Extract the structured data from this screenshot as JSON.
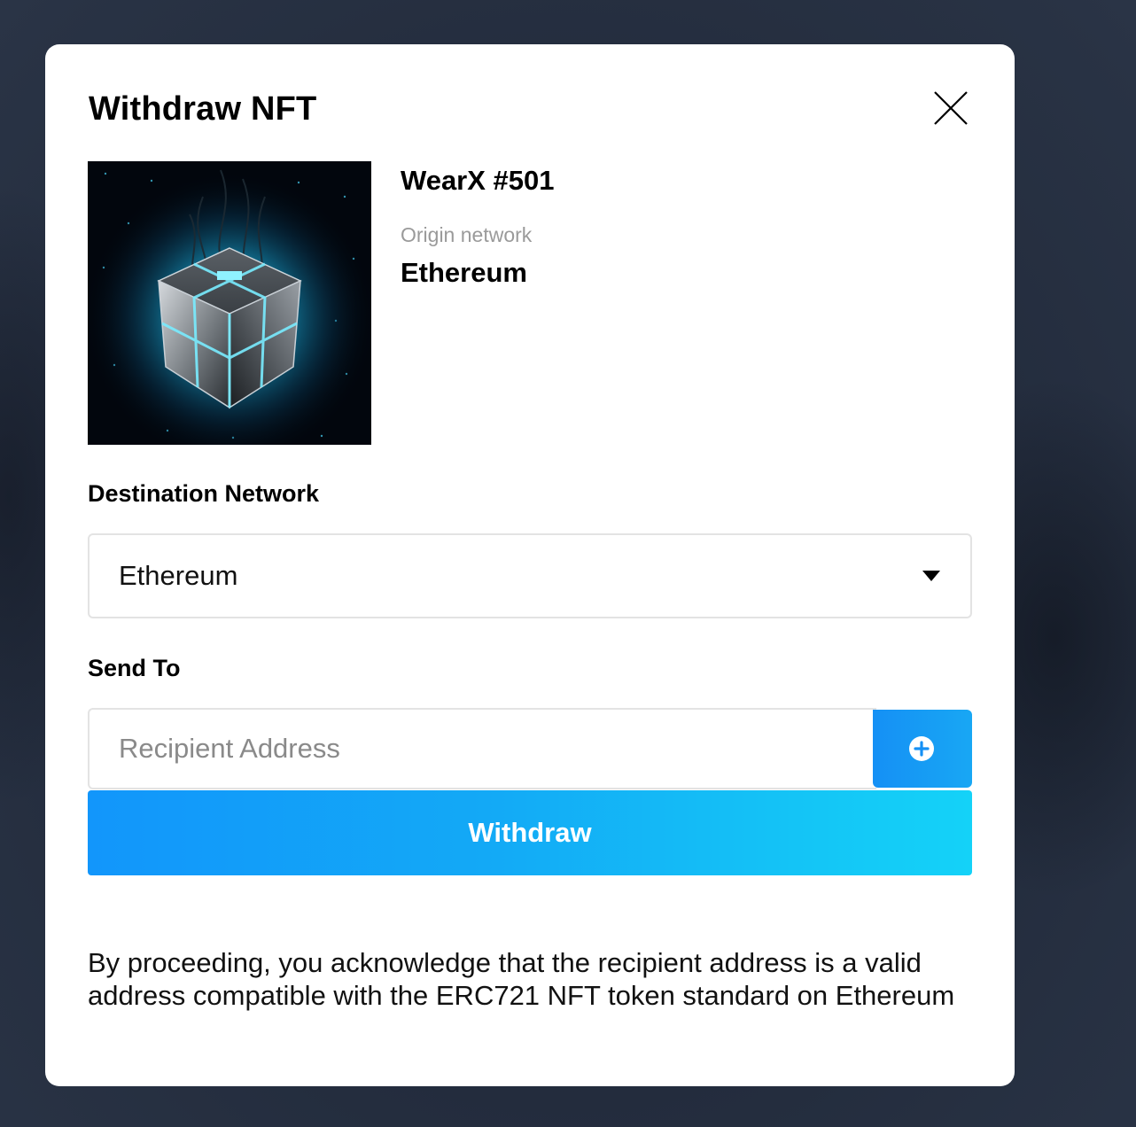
{
  "modal": {
    "title": "Withdraw NFT"
  },
  "nft": {
    "name": "WearX #501",
    "origin_label": "Origin network",
    "origin_value": "Ethereum",
    "image": "glowing-cube-artwork"
  },
  "destination": {
    "label": "Destination Network",
    "selected": "Ethereum"
  },
  "send_to": {
    "label": "Send To",
    "placeholder": "Recipient Address",
    "value": ""
  },
  "actions": {
    "withdraw_label": "Withdraw"
  },
  "disclaimer": "By proceeding, you acknowledge that the recipient address is a valid address compatible with the ERC721 NFT token standard on Ethereum",
  "colors": {
    "accent_start": "#1296fb",
    "accent_end": "#14d2f8",
    "modal_bg": "#ffffff",
    "backdrop": "#232c3d"
  },
  "icons": {
    "close": "close-icon",
    "dropdown": "chevron-down-icon",
    "add": "plus-circle-icon"
  }
}
